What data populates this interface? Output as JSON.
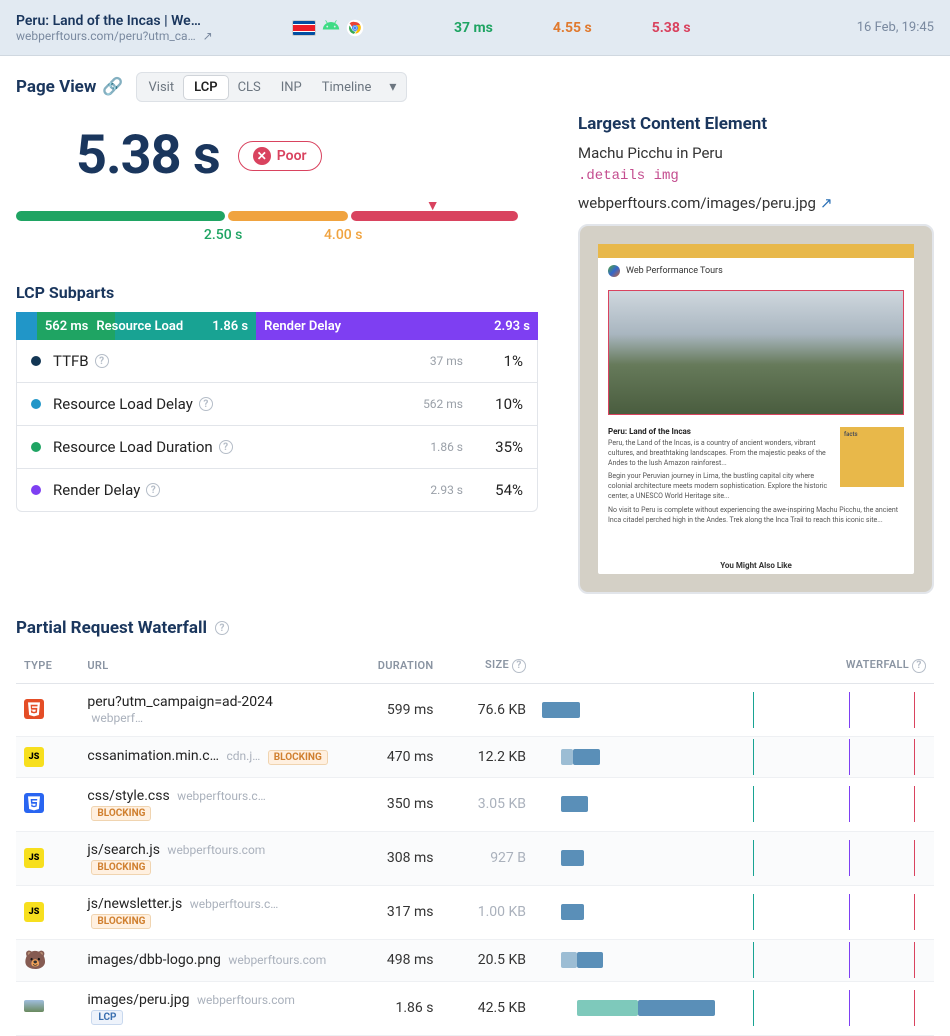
{
  "header": {
    "title": "Peru: Land of the Incas | We…",
    "url": "webperftours.com/peru?utm_ca…",
    "metrics": {
      "ttfb": "37 ms",
      "fcp": "4.55 s",
      "lcp": "5.38 s"
    },
    "date": "16 Feb, 19:45"
  },
  "pageViewLabel": "Page View",
  "tabs": {
    "visit": "Visit",
    "lcp": "LCP",
    "cls": "CLS",
    "inp": "INP",
    "timeline": "Timeline"
  },
  "bigMetric": "5.38 s",
  "poorLabel": "Poor",
  "thresholds": {
    "good": "2.50 s",
    "ni": "4.00 s"
  },
  "subpartsTitle": "LCP Subparts",
  "subpartsBar": {
    "rldVal": "562 ms",
    "rldLabel": "Resource Load",
    "rldurVal": "1.86 s",
    "rdLabel": "Render Delay",
    "rdVal": "2.93 s"
  },
  "subparts": [
    {
      "name": "TTFB",
      "ms": "37 ms",
      "pct": "1%",
      "help": true
    },
    {
      "name": "Resource Load Delay",
      "ms": "562 ms",
      "pct": "10%",
      "help": true
    },
    {
      "name": "Resource Load Duration",
      "ms": "1.86 s",
      "pct": "35%",
      "help": true
    },
    {
      "name": "Render Delay",
      "ms": "2.93 s",
      "pct": "54%",
      "help": true
    }
  ],
  "lce": {
    "title": "Largest Content Element",
    "name": "Machu Picchu in Peru",
    "selector": ".details img",
    "url": "webperftours.com/images/peru.jpg"
  },
  "mock": {
    "brand": "Web Performance Tours",
    "h": "Peru: Land of the Incas",
    "facts": "facts",
    "footer": "You Might Also Like"
  },
  "wfTitle": "Partial Request Waterfall",
  "wfHeaders": {
    "type": "TYPE",
    "url": "URL",
    "duration": "DURATION",
    "size": "SIZE",
    "waterfall": "WATERFALL"
  },
  "requests": [
    {
      "type": "html",
      "name": "peru?utm_campaign=ad-2024",
      "host": "webperf…",
      "blocking": false,
      "lcp": false,
      "duration": "599 ms",
      "size": "76.6 KB",
      "sizeGray": false,
      "bars": [
        {
          "l": 0,
          "w": 10,
          "c": "c-blue"
        }
      ]
    },
    {
      "type": "js",
      "name": "cssanimation.min.c…",
      "host": "cdn.j…",
      "blocking": true,
      "lcp": false,
      "duration": "470 ms",
      "size": "12.2 KB",
      "sizeGray": false,
      "bars": [
        {
          "l": 5,
          "w": 3,
          "c": "c-blue-l"
        },
        {
          "l": 8,
          "w": 7,
          "c": "c-blue"
        }
      ]
    },
    {
      "type": "css",
      "name": "css/style.css",
      "host": "webperftours.c…",
      "blocking": true,
      "lcp": false,
      "duration": "350 ms",
      "size": "3.05 KB",
      "sizeGray": true,
      "bars": [
        {
          "l": 5,
          "w": 7,
          "c": "c-blue"
        }
      ]
    },
    {
      "type": "js",
      "name": "js/search.js",
      "host": "webperftours.com",
      "blocking": true,
      "lcp": false,
      "duration": "308 ms",
      "size": "927 B",
      "sizeGray": true,
      "bars": [
        {
          "l": 5,
          "w": 6,
          "c": "c-blue"
        }
      ]
    },
    {
      "type": "js",
      "name": "js/newsletter.js",
      "host": "webperftours.c…",
      "blocking": true,
      "lcp": false,
      "duration": "317 ms",
      "size": "1.00 KB",
      "sizeGray": true,
      "bars": [
        {
          "l": 5,
          "w": 6,
          "c": "c-blue"
        }
      ]
    },
    {
      "type": "img-bear",
      "name": "images/dbb-logo.png",
      "host": "webperftours.com",
      "blocking": false,
      "lcp": false,
      "duration": "498 ms",
      "size": "20.5 KB",
      "sizeGray": false,
      "bars": [
        {
          "l": 5,
          "w": 4,
          "c": "c-blue-l"
        },
        {
          "l": 9,
          "w": 7,
          "c": "c-blue"
        }
      ]
    },
    {
      "type": "img",
      "name": "images/peru.jpg",
      "host": "webperftours.com",
      "blocking": false,
      "lcp": true,
      "duration": "1.86 s",
      "size": "42.5 KB",
      "sizeGray": false,
      "bars": [
        {
          "l": 9,
          "w": 16,
          "c": "c-teal"
        },
        {
          "l": 25,
          "w": 20,
          "c": "c-blue"
        }
      ]
    }
  ],
  "chart_data": {
    "type": "table",
    "title": "LCP Subparts",
    "categories": [
      "TTFB",
      "Resource Load Delay",
      "Resource Load Duration",
      "Render Delay"
    ],
    "values_ms": [
      37,
      562,
      1860,
      2930
    ],
    "values_pct": [
      1,
      10,
      35,
      54
    ],
    "lcp_total_s": 5.38,
    "thresholds_s": {
      "good": 2.5,
      "needs_improvement": 4.0
    }
  }
}
